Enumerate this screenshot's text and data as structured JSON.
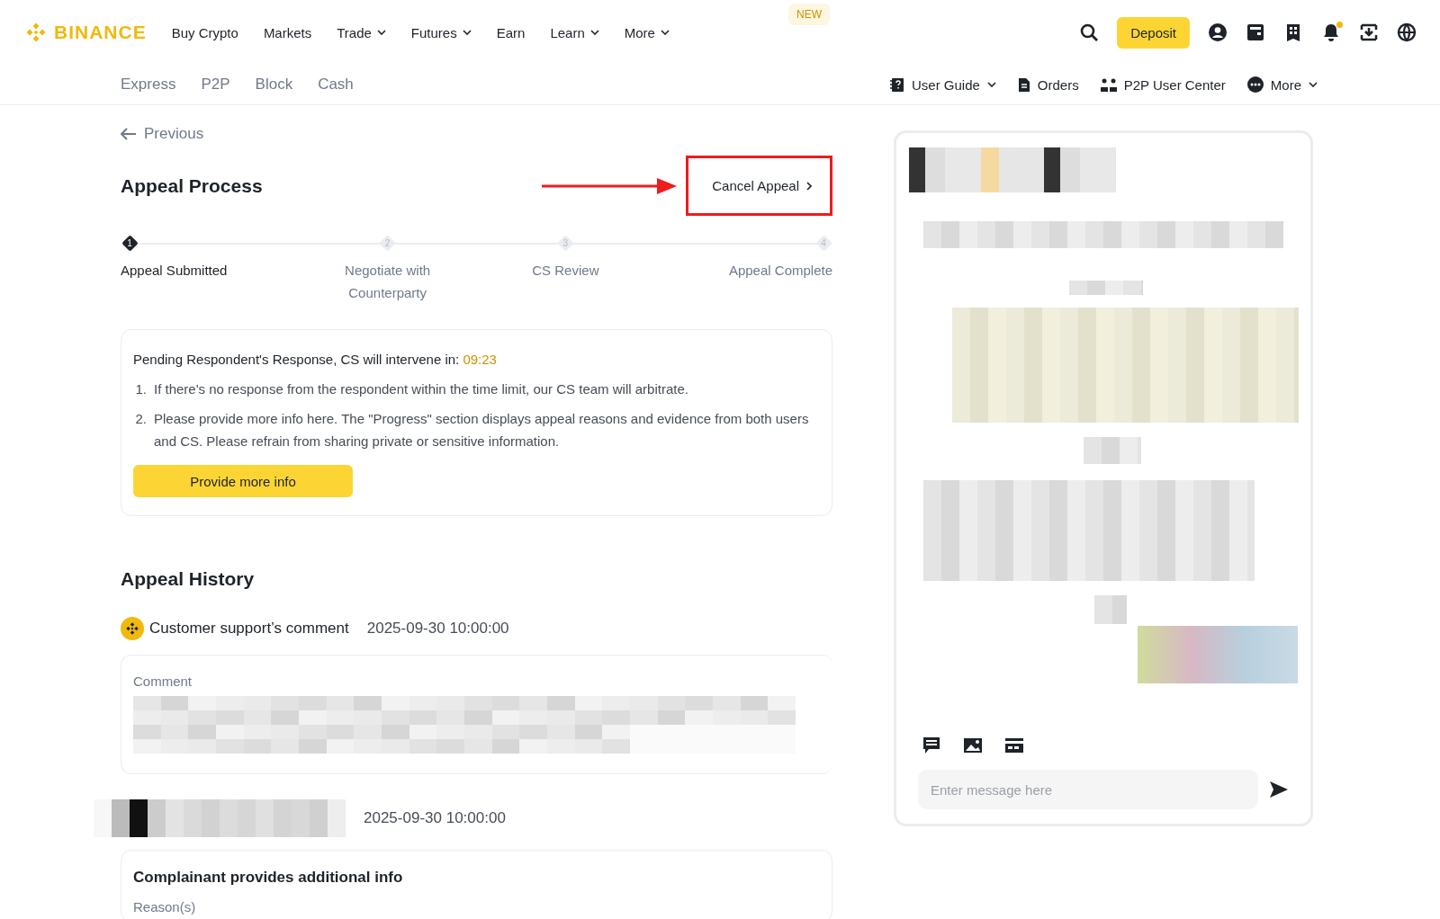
{
  "header": {
    "logo": "BINANCE",
    "nav": [
      {
        "label": "Buy Crypto",
        "dropdown": false
      },
      {
        "label": "Markets",
        "dropdown": false
      },
      {
        "label": "Trade",
        "dropdown": true
      },
      {
        "label": "Futures",
        "dropdown": true
      },
      {
        "label": "Earn",
        "dropdown": false
      },
      {
        "label": "Learn",
        "dropdown": true
      },
      {
        "label": "More",
        "dropdown": true
      }
    ],
    "badge": "NEW",
    "deposit": "Deposit",
    "notification_dot": true
  },
  "subnav": {
    "tabs": [
      {
        "label": "Express",
        "selected": false
      },
      {
        "label": "P2P",
        "selected": false
      },
      {
        "label": "Block",
        "selected": false
      },
      {
        "label": "Cash",
        "selected": false
      }
    ],
    "links": [
      {
        "kind": "guide",
        "label": "User Guide",
        "dropdown": true
      },
      {
        "kind": "orders",
        "label": "Orders",
        "dropdown": false
      },
      {
        "kind": "center",
        "label": "P2P User Center",
        "dropdown": false
      },
      {
        "kind": "more",
        "label": "More",
        "dropdown": true
      }
    ]
  },
  "back": "Previous",
  "appeal": {
    "title": "Appeal Process",
    "cancel": {
      "label": "Cancel Appeal",
      "highlighted": true
    },
    "steps": [
      {
        "number": "1",
        "label": "Appeal Submitted",
        "active": true
      },
      {
        "number": "2",
        "label": "Negotiate with Counterparty",
        "active": false
      },
      {
        "number": "3",
        "label": "CS Review",
        "active": false
      },
      {
        "number": "4",
        "label": "Appeal Complete",
        "active": false
      }
    ],
    "notice": {
      "heading": "Pending Respondent's Response, CS will intervene in:",
      "timer": "09:23",
      "items": [
        {
          "number": "1.",
          "text": "If there's no response from the respondent within the time limit, our CS team will arbitrate."
        },
        {
          "number": "2.",
          "text": "Please provide more info here. The \"Progress\" section displays appeal reasons and evidence from both users and CS. Please refrain from sharing private or sensitive information."
        }
      ],
      "button": "Provide more info"
    }
  },
  "history": {
    "title": "Appeal History",
    "entries": [
      {
        "kind": "support",
        "author": "Customer support’s comment",
        "time": "2025-09-30 10:00:00",
        "card_label": "Comment"
      },
      {
        "kind": "user",
        "time": "2025-09-30 10:00:00",
        "card_title": "Complainant provides additional info",
        "card_label": "Reason(s)"
      }
    ]
  },
  "chat": {
    "placeholder": "Enter message here"
  }
}
